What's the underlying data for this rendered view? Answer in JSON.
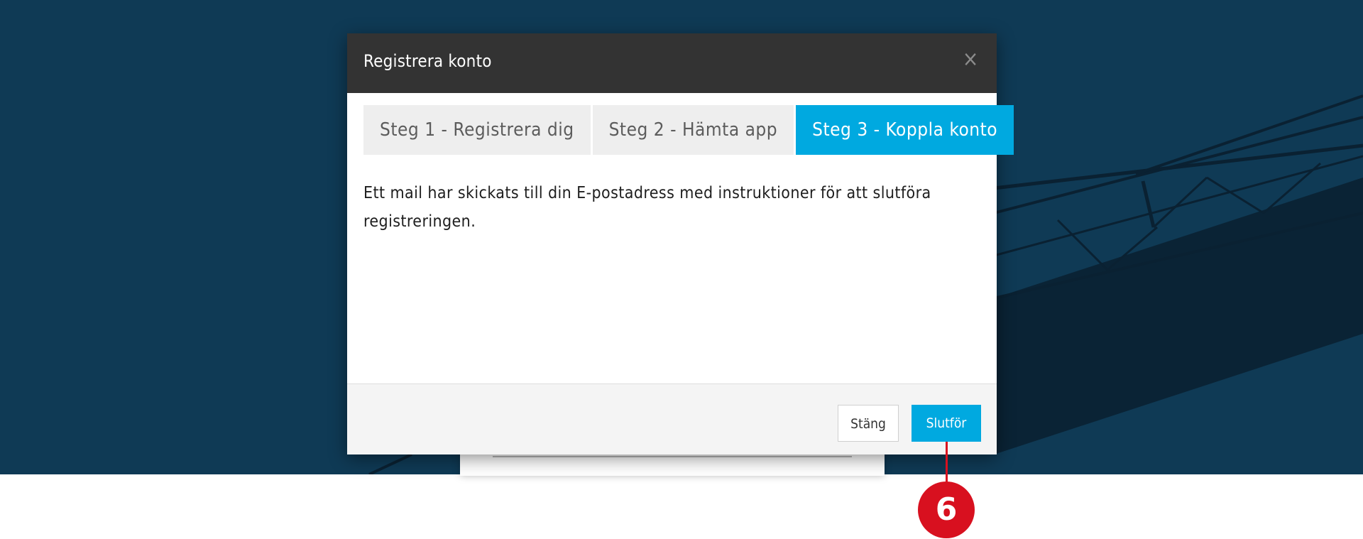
{
  "modal": {
    "title": "Registrera konto",
    "close_glyph": "×"
  },
  "tabs": [
    {
      "label": "Steg 1 - Registrera dig",
      "active": false
    },
    {
      "label": "Steg 2 - Hämta app",
      "active": false
    },
    {
      "label": "Steg 3 - Koppla konto",
      "active": true
    }
  ],
  "message": "Ett mail har skickats till din E-postadress med instruktioner för att slutföra registreringen.",
  "footer": {
    "close_label": "Stäng",
    "finish_label": "Slutför"
  },
  "callout": {
    "number": "6"
  },
  "colors": {
    "accent": "#00a9e0",
    "header": "#333333",
    "callout": "#d8101f",
    "background": "#0f3a55"
  }
}
